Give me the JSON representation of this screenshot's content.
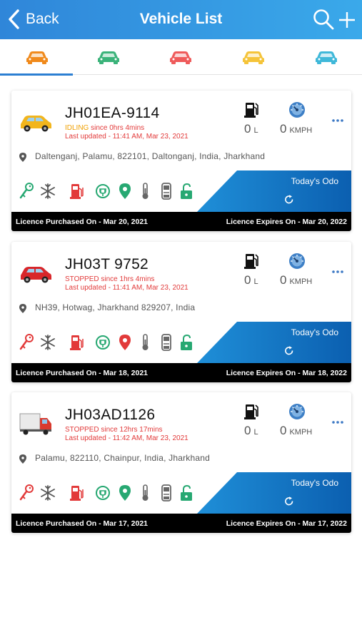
{
  "header": {
    "back_label": "Back",
    "title": "Vehicle List",
    "background": "#2f86d9"
  },
  "tabs": [
    {
      "name": "all",
      "color": "#f08a1c",
      "selected": true
    },
    {
      "name": "running",
      "color": "#3bb37a"
    },
    {
      "name": "stopped",
      "color": "#ef5b5b"
    },
    {
      "name": "idle",
      "color": "#f5c43a"
    },
    {
      "name": "inactive",
      "color": "#3fb8d9"
    }
  ],
  "vehicles": [
    {
      "plate": "JH01EA-9114",
      "state": "IDLING",
      "since": " since 0hrs 4mins",
      "updated": "Last updated - 11:41 AM, Mar 23, 2021",
      "fuel_value": "0",
      "fuel_unit": "L",
      "speed_value": "0",
      "speed_unit": "KMPH",
      "address": "Daltenganj, Palamu, 822101, Daltonganj, India, Jharkhand",
      "odo_label": "Today's Odo",
      "licence_purchased": "Licence Purchased On - Mar 20, 2021",
      "licence_expires": "Licence Expires On - Mar 20, 2022",
      "vehicle_icon": "yellow-car",
      "status_icons": [
        "key-icon",
        "ac-icon",
        "fuel-pump-icon",
        "power-icon",
        "location-pin-icon",
        "temperature-icon",
        "door-icon",
        "lock-icon"
      ],
      "status_colors": [
        "#27a872",
        "#555555",
        "#e23a3a",
        "#27a872",
        "#27a872",
        "#666666",
        "#666666",
        "#27a872"
      ]
    },
    {
      "plate": "JH03T 9752",
      "state": "STOPPED",
      "since": " since 1hrs 4mins",
      "updated": "Last updated - 11:41 AM, Mar 23, 2021",
      "fuel_value": "0",
      "fuel_unit": "L",
      "speed_value": "0",
      "speed_unit": "KMPH",
      "address": "NH39, Hotwag, Jharkhand 829207, India",
      "odo_label": "Today's Odo",
      "licence_purchased": "Licence Purchased On - Mar 18, 2021",
      "licence_expires": "Licence Expires On - Mar 18, 2022",
      "vehicle_icon": "red-car",
      "status_icons": [
        "key-icon",
        "ac-icon",
        "fuel-pump-icon",
        "power-icon",
        "location-pin-icon",
        "temperature-icon",
        "door-icon",
        "lock-icon"
      ],
      "status_colors": [
        "#e23a3a",
        "#555555",
        "#e23a3a",
        "#27a872",
        "#e23a3a",
        "#666666",
        "#666666",
        "#27a872"
      ]
    },
    {
      "plate": "JH03AD1126",
      "state": "STOPPED",
      "since": " since 12hrs 17mins",
      "updated": "Last updated - 11:42 AM, Mar 23, 2021",
      "fuel_value": "0",
      "fuel_unit": "L",
      "speed_value": "0",
      "speed_unit": "KMPH",
      "address": "Palamu, 822110, Chainpur, India, Jharkhand",
      "odo_label": "Today's Odo",
      "licence_purchased": "Licence Purchased On - Mar 17, 2021",
      "licence_expires": "Licence Expires On - Mar 17, 2022",
      "vehicle_icon": "truck",
      "status_icons": [
        "key-icon",
        "ac-icon",
        "fuel-pump-icon",
        "power-icon",
        "location-pin-icon",
        "temperature-icon",
        "door-icon",
        "lock-icon"
      ],
      "status_colors": [
        "#e23a3a",
        "#555555",
        "#e23a3a",
        "#27a872",
        "#27a872",
        "#666666",
        "#666666",
        "#27a872"
      ]
    }
  ]
}
